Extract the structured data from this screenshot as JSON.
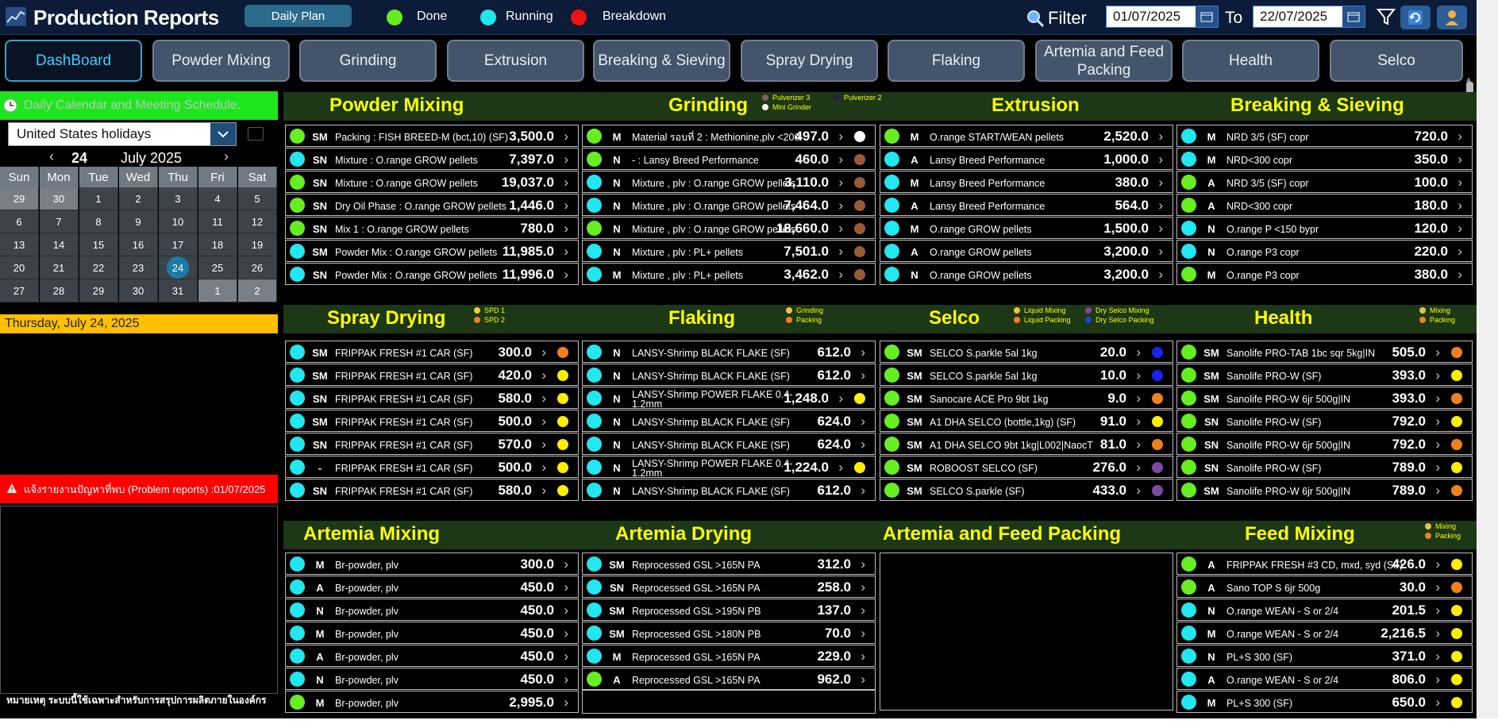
{
  "header": {
    "title": "Production Reports",
    "daily_plan": "Daily Plan",
    "legend": [
      {
        "label": "Done",
        "color": "#66ee22"
      },
      {
        "label": "Running",
        "color": "#22e6f0"
      },
      {
        "label": "Breakdown",
        "color": "#ee1111"
      }
    ],
    "filter_label": "Filter",
    "date_from": "01/07/2025",
    "to_label": "To",
    "date_to": "22/07/2025"
  },
  "tabs": [
    "DashBoard",
    "Powder Mixing",
    "Grinding",
    "Extrusion",
    "Breaking & Sieving",
    "Spray Drying",
    "Flaking",
    "Artemia and Feed Packing",
    "Health",
    "Selco"
  ],
  "calendar": {
    "header": "Daily Calendar and Meeting Schedule.",
    "holiday_select": "United States holidays",
    "day": "24",
    "month": "July 2025",
    "weekdays": [
      "Sun",
      "Mon",
      "Tue",
      "Wed",
      "Thu",
      "Fri",
      "Sat"
    ],
    "weeks": [
      [
        "29",
        "30",
        "1",
        "2",
        "3",
        "4",
        "5"
      ],
      [
        "6",
        "7",
        "8",
        "9",
        "10",
        "11",
        "12"
      ],
      [
        "13",
        "14",
        "15",
        "16",
        "17",
        "18",
        "19"
      ],
      [
        "20",
        "21",
        "22",
        "23",
        "24",
        "25",
        "26"
      ],
      [
        "27",
        "28",
        "29",
        "30",
        "31",
        "1",
        "2"
      ]
    ],
    "selected_date": "Thursday, July 24, 2025"
  },
  "problem_reports": "แจ้งรายงานปัญหาที่พบ (Problem reports) :01/07/2025",
  "footnote": "หมายเหตุ ระบบนี้ใช้เฉพาะสำหรับการสรุปการผลิตภายในองค์กร",
  "colors": {
    "done": "#66ee22",
    "running": "#22e6f0",
    "breakdown": "#ee1111",
    "section_bg": "#1c3817",
    "title": "#ffff00"
  },
  "sections": [
    {
      "title": "Powder Mixing",
      "legend": [],
      "rows": [
        {
          "status": "done",
          "shift": "SM",
          "product": "Packing : FISH BREED-M (bct,10) (SF)",
          "value": "3,500.0",
          "dot": ""
        },
        {
          "status": "running",
          "shift": "SN",
          "product": "Mixture : O.range GROW pellets",
          "value": "7,397.0",
          "dot": ""
        },
        {
          "status": "done",
          "shift": "SN",
          "product": "Mixture : O.range GROW pellets",
          "value": "19,037.0",
          "dot": ""
        },
        {
          "status": "done",
          "shift": "SN",
          "product": "Dry Oil Phase : O.range GROW pellets",
          "value": "1,446.0",
          "dot": ""
        },
        {
          "status": "done",
          "shift": "SN",
          "product": "Mix 1 : O.range GROW pellets",
          "value": "780.0",
          "dot": ""
        },
        {
          "status": "running",
          "shift": "SM",
          "product": "Powder Mix : O.range GROW pellets",
          "value": "11,985.0",
          "dot": ""
        },
        {
          "status": "running",
          "shift": "SN",
          "product": "Powder Mix : O.range GROW pellets",
          "value": "11,996.0",
          "dot": ""
        }
      ]
    },
    {
      "title": "Grinding",
      "legend": [
        {
          "label": "Pulverizer 3",
          "color": "#8a5a66"
        },
        {
          "label": "Pulverizer 2",
          "color": "#2b1a4a"
        },
        {
          "label": "Mini Grinder",
          "color": "#ffffff"
        }
      ],
      "rows": [
        {
          "status": "done",
          "shift": "M",
          "product": "Material รอบที่ 2 : Methionine,plv <200",
          "value": "497.0",
          "dot": "#ffffff"
        },
        {
          "status": "done",
          "shift": "N",
          "product": "- : Lansy Breed Performance",
          "value": "460.0",
          "dot": "#9a5a36"
        },
        {
          "status": "running",
          "shift": "N",
          "product": "Mixture , plv : O.range GROW pellets",
          "value": "3,110.0",
          "dot": "#9a5a36"
        },
        {
          "status": "running",
          "shift": "N",
          "product": "Mixture , plv : O.range GROW pellets",
          "value": "7,464.0",
          "dot": "#9a5a36"
        },
        {
          "status": "done",
          "shift": "N",
          "product": "Mixture , plv : O.range GROW pellets",
          "value": "18,660.0",
          "dot": "#9a5a36"
        },
        {
          "status": "running",
          "shift": "N",
          "product": "Mixture , plv : PL+ pellets",
          "value": "7,501.0",
          "dot": "#9a5a36"
        },
        {
          "status": "running",
          "shift": "M",
          "product": "Mixture , plv : PL+ pellets",
          "value": "3,462.0",
          "dot": "#9a5a36"
        }
      ]
    },
    {
      "title": "Extrusion",
      "legend": [],
      "rows": [
        {
          "status": "done",
          "shift": "M",
          "product": "O.range START/WEAN pellets",
          "value": "2,520.0",
          "dot": ""
        },
        {
          "status": "running",
          "shift": "A",
          "product": "Lansy Breed Performance",
          "value": "1,000.0",
          "dot": ""
        },
        {
          "status": "running",
          "shift": "M",
          "product": "Lansy Breed Performance",
          "value": "380.0",
          "dot": ""
        },
        {
          "status": "running",
          "shift": "A",
          "product": "Lansy Breed Performance",
          "value": "564.0",
          "dot": ""
        },
        {
          "status": "running",
          "shift": "M",
          "product": "O.range GROW pellets",
          "value": "1,500.0",
          "dot": ""
        },
        {
          "status": "running",
          "shift": "A",
          "product": "O.range GROW pellets",
          "value": "3,200.0",
          "dot": ""
        },
        {
          "status": "running",
          "shift": "N",
          "product": "O.range GROW pellets",
          "value": "3,200.0",
          "dot": ""
        }
      ]
    },
    {
      "title": "Breaking & Sieving",
      "legend": [],
      "rows": [
        {
          "status": "running",
          "shift": "M",
          "product": "NRD 3/5 (SF) copr",
          "value": "720.0",
          "dot": ""
        },
        {
          "status": "running",
          "shift": "M",
          "product": "NRD<300 copr",
          "value": "350.0",
          "dot": ""
        },
        {
          "status": "done",
          "shift": "A",
          "product": "NRD 3/5 (SF) copr",
          "value": "100.0",
          "dot": ""
        },
        {
          "status": "done",
          "shift": "A",
          "product": "NRD<300 copr",
          "value": "180.0",
          "dot": ""
        },
        {
          "status": "running",
          "shift": "N",
          "product": "O.range P <150 bypr",
          "value": "120.0",
          "dot": ""
        },
        {
          "status": "running",
          "shift": "N",
          "product": "O.range P3 copr",
          "value": "220.0",
          "dot": ""
        },
        {
          "status": "done",
          "shift": "M",
          "product": "O.range P3 copr",
          "value": "380.0",
          "dot": ""
        }
      ]
    },
    {
      "title": "Spray Drying",
      "legend": [
        {
          "label": "SPD 1",
          "color": "#f0d020"
        },
        {
          "label": "SPD 2",
          "color": "#f08020"
        }
      ],
      "rows": [
        {
          "status": "running",
          "shift": "SM",
          "product": "FRIPPAK FRESH #1 CAR (SF)",
          "value": "300.0",
          "dot": "#f08020"
        },
        {
          "status": "running",
          "shift": "SM",
          "product": "FRIPPAK FRESH #1 CAR (SF)",
          "value": "420.0",
          "dot": "#ffee00"
        },
        {
          "status": "running",
          "shift": "SN",
          "product": "FRIPPAK FRESH #1 CAR (SF)",
          "value": "580.0",
          "dot": "#ffee00"
        },
        {
          "status": "running",
          "shift": "SM",
          "product": "FRIPPAK FRESH #1 CAR (SF)",
          "value": "500.0",
          "dot": "#ffee00"
        },
        {
          "status": "running",
          "shift": "SN",
          "product": "FRIPPAK FRESH #1 CAR (SF)",
          "value": "570.0",
          "dot": "#ffee00"
        },
        {
          "status": "running",
          "shift": "-",
          "product": "FRIPPAK FRESH #1 CAR (SF)",
          "value": "500.0",
          "dot": "#ffee00"
        },
        {
          "status": "running",
          "shift": "SN",
          "product": "FRIPPAK FRESH #1 CAR (SF)",
          "value": "580.0",
          "dot": "#ffee00"
        }
      ]
    },
    {
      "title": "Flaking",
      "legend": [
        {
          "label": "Grinding",
          "color": "#f0c040"
        },
        {
          "label": "Packing",
          "color": "#f08020"
        }
      ],
      "rows": [
        {
          "status": "running",
          "shift": "N",
          "product": "LANSY-Shrimp BLACK FLAKE (SF)",
          "value": "612.0",
          "dot": ""
        },
        {
          "status": "running",
          "shift": "N",
          "product": "LANSY-Shrimp BLACK FLAKE (SF)",
          "value": "612.0",
          "dot": ""
        },
        {
          "status": "running",
          "shift": "N",
          "product": "LANSY-Shrimp POWER FLAKE 0.4-1.2mm",
          "value": "1,248.0",
          "dot": "#ffee00"
        },
        {
          "status": "running",
          "shift": "N",
          "product": "LANSY-Shrimp BLACK FLAKE (SF)",
          "value": "624.0",
          "dot": ""
        },
        {
          "status": "running",
          "shift": "N",
          "product": "LANSY-Shrimp BLACK FLAKE (SF)",
          "value": "624.0",
          "dot": ""
        },
        {
          "status": "running",
          "shift": "N",
          "product": "LANSY-Shrimp POWER FLAKE 0.4-1.2mm",
          "value": "1,224.0",
          "dot": "#ffee00"
        },
        {
          "status": "running",
          "shift": "N",
          "product": "LANSY-Shrimp BLACK FLAKE (SF)",
          "value": "612.0",
          "dot": ""
        }
      ]
    },
    {
      "title": "Selco",
      "legend": [
        {
          "label": "Liquid Mixing",
          "color": "#f0c040"
        },
        {
          "label": "Dry Selco Mixing",
          "color": "#7a4aa0"
        },
        {
          "label": "Liquid Packing",
          "color": "#f08020"
        },
        {
          "label": "Dry Selco Packing",
          "color": "#2040d0"
        }
      ],
      "rows": [
        {
          "status": "done",
          "shift": "SM",
          "product": "SELCO S.parkle 5al 1kg",
          "value": "20.0",
          "dot": "#1a22ee"
        },
        {
          "status": "done",
          "shift": "SM",
          "product": "SELCO S.parkle 5al 1kg",
          "value": "10.0",
          "dot": "#1a22ee"
        },
        {
          "status": "done",
          "shift": "SM",
          "product": "Sanocare ACE Pro 9bt 1kg",
          "value": "9.0",
          "dot": "#f08020"
        },
        {
          "status": "done",
          "shift": "SM",
          "product": "A1 DHA SELCO (bottle,1kg) (SF)",
          "value": "91.0",
          "dot": "#ffee00"
        },
        {
          "status": "done",
          "shift": "SM",
          "product": "A1 DHA SELCO 9bt 1kg|L002|NaocT",
          "value": "81.0",
          "dot": "#f08020"
        },
        {
          "status": "done",
          "shift": "SM",
          "product": "ROBOOST SELCO (SF)",
          "value": "276.0",
          "dot": "#7a4aa0"
        },
        {
          "status": "done",
          "shift": "SM",
          "product": "SELCO S.parkle (SF)",
          "value": "433.0",
          "dot": "#7a4aa0"
        }
      ]
    },
    {
      "title": "Health",
      "legend": [
        {
          "label": "Mixing",
          "color": "#f0c040"
        },
        {
          "label": "Packing",
          "color": "#f08020"
        }
      ],
      "rows": [
        {
          "status": "done",
          "shift": "SM",
          "product": "Sanolife PRO-TAB 1bc sqr 5kg|IN",
          "value": "505.0",
          "dot": "#f08020"
        },
        {
          "status": "done",
          "shift": "SM",
          "product": "Sanolife PRO-W (SF)",
          "value": "393.0",
          "dot": "#ffee00"
        },
        {
          "status": "done",
          "shift": "SM",
          "product": "Sanolife PRO-W 6jr 500g|IN",
          "value": "393.0",
          "dot": "#f08020"
        },
        {
          "status": "done",
          "shift": "SN",
          "product": "Sanolife PRO-W (SF)",
          "value": "792.0",
          "dot": "#ffee00"
        },
        {
          "status": "done",
          "shift": "SN",
          "product": "Sanolife PRO-W 6jr 500g|IN",
          "value": "792.0",
          "dot": "#f08020"
        },
        {
          "status": "done",
          "shift": "SN",
          "product": "Sanolife PRO-W (SF)",
          "value": "789.0",
          "dot": "#ffee00"
        },
        {
          "status": "done",
          "shift": "SM",
          "product": "Sanolife PRO-W 6jr 500g|IN",
          "value": "789.0",
          "dot": "#f08020"
        }
      ]
    },
    {
      "title": "Artemia Mixing",
      "legend": [],
      "rows": [
        {
          "status": "running",
          "shift": "M",
          "product": "Br-powder, plv",
          "value": "300.0",
          "dot": ""
        },
        {
          "status": "running",
          "shift": "A",
          "product": "Br-powder, plv",
          "value": "450.0",
          "dot": ""
        },
        {
          "status": "running",
          "shift": "N",
          "product": "Br-powder, plv",
          "value": "450.0",
          "dot": ""
        },
        {
          "status": "running",
          "shift": "M",
          "product": "Br-powder, plv",
          "value": "450.0",
          "dot": ""
        },
        {
          "status": "running",
          "shift": "A",
          "product": "Br-powder, plv",
          "value": "450.0",
          "dot": ""
        },
        {
          "status": "running",
          "shift": "N",
          "product": "Br-powder, plv",
          "value": "450.0",
          "dot": ""
        },
        {
          "status": "done",
          "shift": "M",
          "product": "Br-powder, plv",
          "value": "2,995.0",
          "dot": ""
        }
      ]
    },
    {
      "title": "Artemia Drying",
      "legend": [],
      "rows": [
        {
          "status": "running",
          "shift": "SM",
          "product": "Reprocessed GSL >165N PA",
          "value": "312.0",
          "dot": ""
        },
        {
          "status": "running",
          "shift": "SN",
          "product": "Reprocessed GSL >165N PA",
          "value": "258.0",
          "dot": ""
        },
        {
          "status": "running",
          "shift": "SM",
          "product": "Reprocessed GSL >195N PB",
          "value": "137.0",
          "dot": ""
        },
        {
          "status": "running",
          "shift": "SM",
          "product": "Reprocessed GSL >180N PB",
          "value": "70.0",
          "dot": ""
        },
        {
          "status": "running",
          "shift": "M",
          "product": "Reprocessed GSL >165N PA",
          "value": "229.0",
          "dot": ""
        },
        {
          "status": "done",
          "shift": "A",
          "product": "Reprocessed GSL >165N PA",
          "value": "962.0",
          "dot": ""
        }
      ]
    },
    {
      "title": "Artemia and Feed Packing",
      "legend": [],
      "rows": []
    },
    {
      "title": "Feed Mixing",
      "legend": [
        {
          "label": "Mixing",
          "color": "#f0c040"
        },
        {
          "label": "Packing",
          "color": "#f08020"
        }
      ],
      "rows": [
        {
          "status": "done",
          "shift": "A",
          "product": "FRIPPAK FRESH #3 CD, mxd, syd (SF)",
          "value": "426.0",
          "dot": "#ffee00"
        },
        {
          "status": "done",
          "shift": "A",
          "product": "Sano TOP S 6jr 500g",
          "value": "30.0",
          "dot": "#f08020"
        },
        {
          "status": "running",
          "shift": "N",
          "product": "O.range WEAN - S or 2/4",
          "value": "201.5",
          "dot": "#ffee00"
        },
        {
          "status": "running",
          "shift": "M",
          "product": "O.range WEAN - S or 2/4",
          "value": "2,216.5",
          "dot": "#ffee00"
        },
        {
          "status": "running",
          "shift": "N",
          "product": "PL+S 300 (SF)",
          "value": "371.0",
          "dot": "#ffee00"
        },
        {
          "status": "running",
          "shift": "A",
          "product": "O.range WEAN - S or 2/4",
          "value": "806.0",
          "dot": "#ffee00"
        },
        {
          "status": "running",
          "shift": "M",
          "product": "PL+S 300 (SF)",
          "value": "650.0",
          "dot": "#ffee00"
        }
      ]
    }
  ]
}
